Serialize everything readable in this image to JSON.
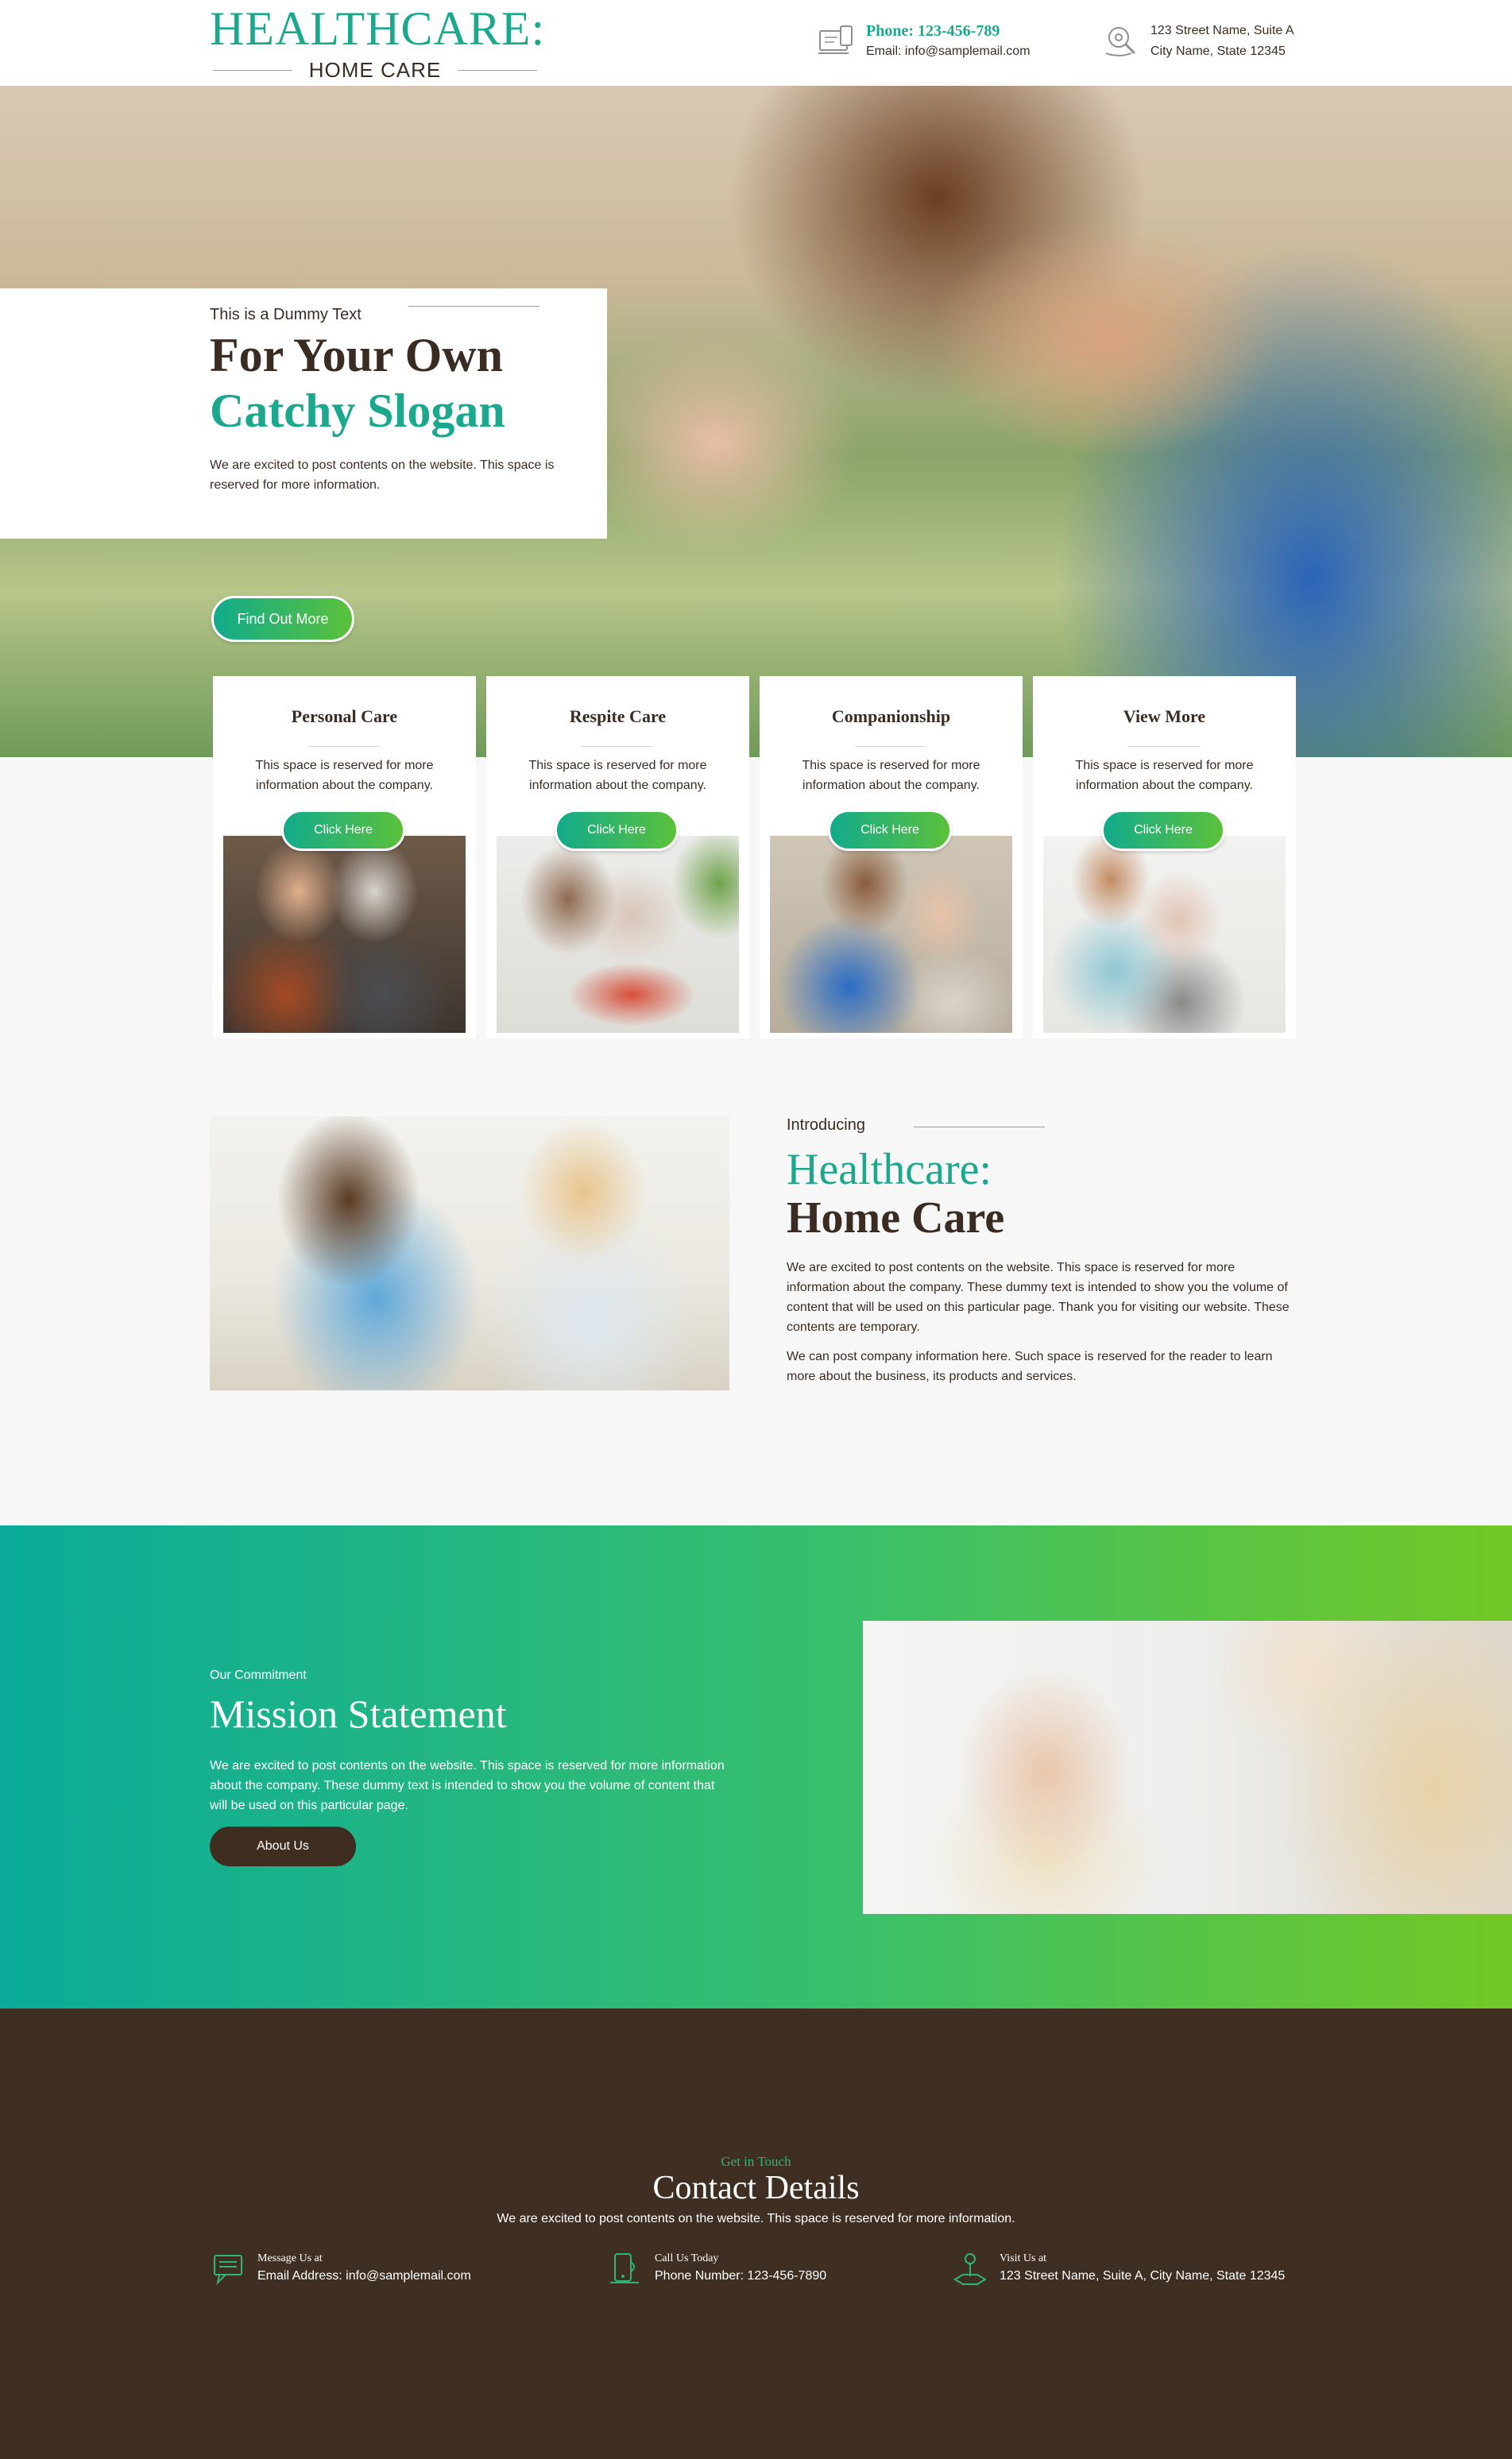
{
  "header": {
    "logo_title": "HEALTHCARE:",
    "logo_subtitle": "HOME CARE",
    "phone": "Phone: 123-456-789",
    "email": "Email: info@samplemail.com",
    "address_line1": "123 Street Name, Suite A",
    "address_line2": "City Name, State 12345"
  },
  "hero": {
    "kicker": "This is a Dummy Text",
    "headline1": "For Your Own",
    "headline2": "Catchy Slogan",
    "text": "We are excited to post contents on the website. This space is reserved for more information.",
    "button": "Find Out More"
  },
  "services": [
    {
      "title": "Personal Care",
      "text": "This space is reserved for more information about the company.",
      "button": "Click Here"
    },
    {
      "title": "Respite Care",
      "text": "This space is reserved for more information about the company.",
      "button": "Click Here"
    },
    {
      "title": "Companionship",
      "text": "This space is reserved for more information about the company.",
      "button": "Click Here"
    },
    {
      "title": "View More",
      "text": "This space is reserved for more information about the company.",
      "button": "Click Here"
    }
  ],
  "intro": {
    "kicker": "Introducing",
    "title1": "Healthcare:",
    "title2": "Home Care",
    "paragraph1": "We are excited to post contents on the website. This space is reserved for more information about the company. These dummy text is intended to show you the volume of content that will be used on this particular page. Thank you for visiting our website. These contents are temporary.",
    "paragraph2": "We can post company information here. Such space is reserved for the reader to learn more about the business, its products and services."
  },
  "mission": {
    "kicker": "Our Commitment",
    "title": "Mission Statement",
    "text": "We are excited to post contents on the website. This space is reserved for more information about the company. These dummy text is intended to show you the volume of content that will be used on this particular page.",
    "button": "About Us"
  },
  "footer": {
    "kicker": "Get in Touch",
    "title": "Contact Details",
    "text": "We are excited to post contents on the website. This space is reserved for more information.",
    "contacts": [
      {
        "title": "Message Us at",
        "text": "Email Address: info@samplemail.com",
        "icon": "chat-icon"
      },
      {
        "title": "Call Us Today",
        "text": "Phone Number: 123-456-7890",
        "icon": "phone-icon"
      },
      {
        "title": "Visit Us at",
        "text": "123 Street Name, Suite A, City Name, State 12345",
        "icon": "location-icon"
      }
    ]
  },
  "colors": {
    "brand_green": "#1aa88f",
    "brand_brown": "#3e2f22",
    "gradient_start": "#0aab9a",
    "gradient_end": "#73c825"
  }
}
